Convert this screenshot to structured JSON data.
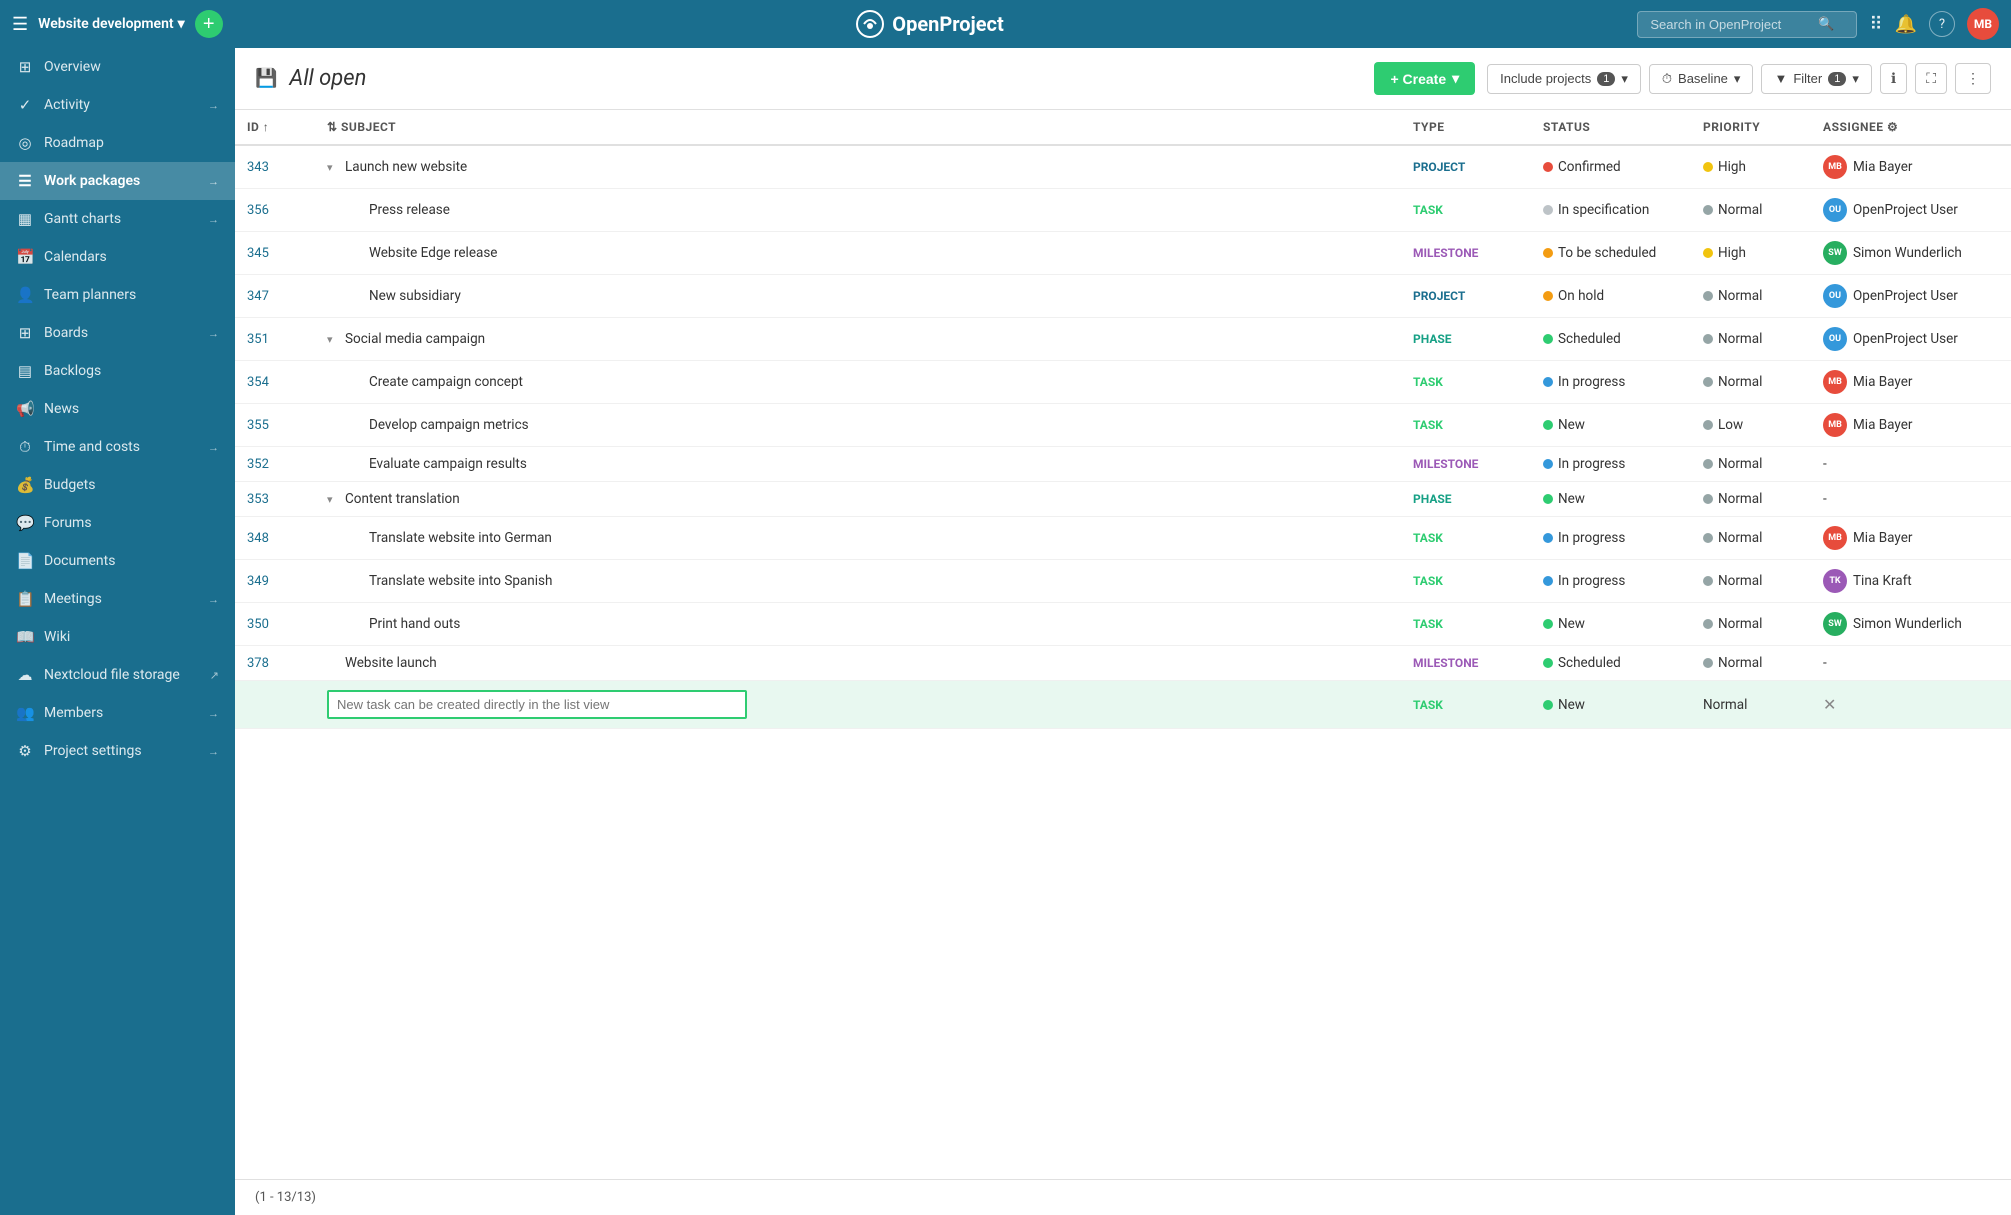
{
  "topNav": {
    "hamburger": "☰",
    "projectName": "Website development",
    "dropdownArrow": "▾",
    "plusLabel": "+",
    "logoText": "OpenProject",
    "searchPlaceholder": "Search in OpenProject",
    "navIcons": [
      "⠿",
      "🔔",
      "?"
    ],
    "avatarInitials": "MB",
    "avatarColor": "#e74c3c"
  },
  "sidebar": {
    "items": [
      {
        "id": "overview",
        "icon": "⊞",
        "label": "Overview",
        "arrow": "",
        "active": false
      },
      {
        "id": "activity",
        "icon": "✓",
        "label": "Activity",
        "arrow": "→",
        "active": false
      },
      {
        "id": "roadmap",
        "icon": "◎",
        "label": "Roadmap",
        "arrow": "",
        "active": false
      },
      {
        "id": "work-packages",
        "icon": "☰",
        "label": "Work packages",
        "arrow": "→",
        "active": true
      },
      {
        "id": "gantt-charts",
        "icon": "▦",
        "label": "Gantt charts",
        "arrow": "→",
        "active": false
      },
      {
        "id": "calendars",
        "icon": "📅",
        "label": "Calendars",
        "arrow": "",
        "active": false
      },
      {
        "id": "team-planners",
        "icon": "👤",
        "label": "Team planners",
        "arrow": "",
        "active": false
      },
      {
        "id": "boards",
        "icon": "⊞",
        "label": "Boards",
        "arrow": "→",
        "active": false
      },
      {
        "id": "backlogs",
        "icon": "▤",
        "label": "Backlogs",
        "arrow": "",
        "active": false
      },
      {
        "id": "news",
        "icon": "📢",
        "label": "News",
        "arrow": "",
        "active": false
      },
      {
        "id": "time-costs",
        "icon": "⏱",
        "label": "Time and costs",
        "arrow": "→",
        "active": false
      },
      {
        "id": "budgets",
        "icon": "💰",
        "label": "Budgets",
        "arrow": "",
        "active": false
      },
      {
        "id": "forums",
        "icon": "💬",
        "label": "Forums",
        "arrow": "",
        "active": false
      },
      {
        "id": "documents",
        "icon": "📄",
        "label": "Documents",
        "arrow": "",
        "active": false
      },
      {
        "id": "meetings",
        "icon": "📋",
        "label": "Meetings",
        "arrow": "→",
        "active": false
      },
      {
        "id": "wiki",
        "icon": "📖",
        "label": "Wiki",
        "arrow": "",
        "active": false
      },
      {
        "id": "nextcloud",
        "icon": "☁",
        "label": "Nextcloud file storage",
        "arrow": "↗",
        "active": false
      },
      {
        "id": "members",
        "icon": "👥",
        "label": "Members",
        "arrow": "→",
        "active": false
      },
      {
        "id": "project-settings",
        "icon": "⚙",
        "label": "Project settings",
        "arrow": "→",
        "active": false
      }
    ]
  },
  "header": {
    "saveIcon": "💾",
    "title": "All open",
    "createLabel": "+ Create",
    "includeProjectsLabel": "Include projects",
    "includeProjectsCount": "1",
    "baselineLabel": "Baseline",
    "filterLabel": "Filter",
    "filterCount": "1",
    "infoIcon": "ℹ",
    "fullscreenIcon": "⛶",
    "moreIcon": "⋮"
  },
  "table": {
    "columns": [
      "ID",
      "SUBJECT",
      "TYPE",
      "STATUS",
      "PRIORITY",
      "ASSIGNEE"
    ],
    "idSort": "↑",
    "subjectIcon": "⇅",
    "settingsIcon": "⚙",
    "rows": [
      {
        "id": "343",
        "indent": 0,
        "collapse": "▾",
        "subject": "Launch new website",
        "type": "PROJECT",
        "typeClass": "type-project",
        "statusDot": "#e74c3c",
        "status": "Confirmed",
        "priorityDot": "#f1c40f",
        "priority": "High",
        "assigneeColor": "#e74c3c",
        "assigneeInitials": "MB",
        "assignee": "Mia Bayer"
      },
      {
        "id": "356",
        "indent": 1,
        "collapse": "",
        "subject": "Press release",
        "type": "TASK",
        "typeClass": "type-task",
        "statusDot": "#bdc3c7",
        "status": "In specification",
        "priorityDot": "#95a5a6",
        "priority": "Normal",
        "assigneeColor": "#3498db",
        "assigneeInitials": "OU",
        "assignee": "OpenProject User"
      },
      {
        "id": "345",
        "indent": 1,
        "collapse": "",
        "subject": "Website Edge release",
        "type": "MILESTONE",
        "typeClass": "type-milestone",
        "statusDot": "#f39c12",
        "status": "To be scheduled",
        "priorityDot": "#f1c40f",
        "priority": "High",
        "assigneeColor": "#27ae60",
        "assigneeInitials": "SW",
        "assignee": "Simon Wunderlich"
      },
      {
        "id": "347",
        "indent": 1,
        "collapse": "",
        "subject": "New subsidiary",
        "type": "PROJECT",
        "typeClass": "type-project",
        "statusDot": "#f39c12",
        "status": "On hold",
        "priorityDot": "#95a5a6",
        "priority": "Normal",
        "assigneeColor": "#3498db",
        "assigneeInitials": "OU",
        "assignee": "OpenProject User"
      },
      {
        "id": "351",
        "indent": 0,
        "collapse": "▾",
        "subject": "Social media campaign",
        "type": "PHASE",
        "typeClass": "type-phase",
        "statusDot": "#2ecc71",
        "status": "Scheduled",
        "priorityDot": "#95a5a6",
        "priority": "Normal",
        "assigneeColor": "#3498db",
        "assigneeInitials": "OU",
        "assignee": "OpenProject User"
      },
      {
        "id": "354",
        "indent": 1,
        "collapse": "",
        "subject": "Create campaign concept",
        "type": "TASK",
        "typeClass": "type-task",
        "statusDot": "#3498db",
        "status": "In progress",
        "priorityDot": "#95a5a6",
        "priority": "Normal",
        "assigneeColor": "#e74c3c",
        "assigneeInitials": "MB",
        "assignee": "Mia Bayer"
      },
      {
        "id": "355",
        "indent": 1,
        "collapse": "",
        "subject": "Develop campaign metrics",
        "type": "TASK",
        "typeClass": "type-task",
        "statusDot": "#2ecc71",
        "status": "New",
        "priorityDot": "#95a5a6",
        "priority": "Low",
        "assigneeColor": "#e74c3c",
        "assigneeInitials": "MB",
        "assignee": "Mia Bayer"
      },
      {
        "id": "352",
        "indent": 1,
        "collapse": "",
        "subject": "Evaluate campaign results",
        "type": "MILESTONE",
        "typeClass": "type-milestone",
        "statusDot": "#3498db",
        "status": "In progress",
        "priorityDot": "#95a5a6",
        "priority": "Normal",
        "assigneeColor": "",
        "assigneeInitials": "",
        "assignee": "-"
      },
      {
        "id": "353",
        "indent": 0,
        "collapse": "▾",
        "subject": "Content translation",
        "type": "PHASE",
        "typeClass": "type-phase",
        "statusDot": "#2ecc71",
        "status": "New",
        "priorityDot": "#95a5a6",
        "priority": "Normal",
        "assigneeColor": "",
        "assigneeInitials": "",
        "assignee": "-"
      },
      {
        "id": "348",
        "indent": 1,
        "collapse": "",
        "subject": "Translate website into German",
        "type": "TASK",
        "typeClass": "type-task",
        "statusDot": "#3498db",
        "status": "In progress",
        "priorityDot": "#95a5a6",
        "priority": "Normal",
        "assigneeColor": "#e74c3c",
        "assigneeInitials": "MB",
        "assignee": "Mia Bayer"
      },
      {
        "id": "349",
        "indent": 1,
        "collapse": "",
        "subject": "Translate website into Spanish",
        "type": "TASK",
        "typeClass": "type-task",
        "statusDot": "#3498db",
        "status": "In progress",
        "priorityDot": "#95a5a6",
        "priority": "Normal",
        "assigneeColor": "#9b59b6",
        "assigneeInitials": "TK",
        "assignee": "Tina Kraft"
      },
      {
        "id": "350",
        "indent": 1,
        "collapse": "",
        "subject": "Print hand outs",
        "type": "TASK",
        "typeClass": "type-task",
        "statusDot": "#2ecc71",
        "status": "New",
        "priorityDot": "#95a5a6",
        "priority": "Normal",
        "assigneeColor": "#27ae60",
        "assigneeInitials": "SW",
        "assignee": "Simon Wunderlich"
      },
      {
        "id": "378",
        "indent": 0,
        "collapse": "",
        "subject": "Website launch",
        "type": "MILESTONE",
        "typeClass": "type-milestone",
        "statusDot": "#2ecc71",
        "status": "Scheduled",
        "priorityDot": "#95a5a6",
        "priority": "Normal",
        "assigneeColor": "",
        "assigneeInitials": "",
        "assignee": "-"
      }
    ],
    "newTaskPlaceholder": "New task can be created directly in the list view",
    "newTaskType": "TASK",
    "newTaskStatus": "New",
    "newTaskPriority": "Normal",
    "newTaskAssignee": "-",
    "pagination": "(1 - 13/13)"
  }
}
